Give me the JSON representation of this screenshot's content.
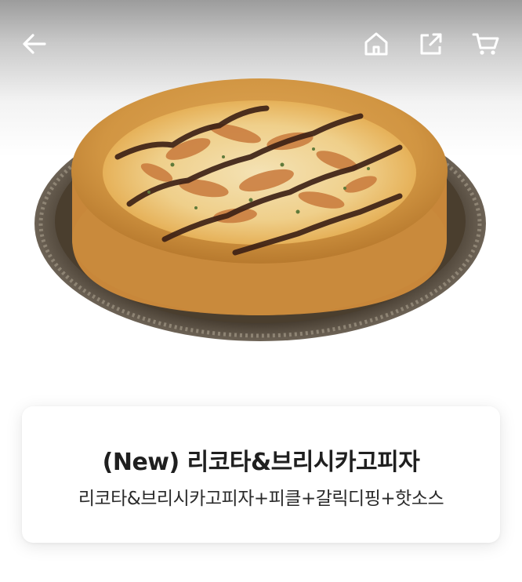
{
  "header": {
    "icons": [
      "back-arrow-icon",
      "home-icon",
      "share-icon",
      "cart-icon"
    ],
    "icon_color": "#ffffff"
  },
  "product": {
    "image_alt": "",
    "title": "(New) 리코타&브리시카고피자",
    "description": "리코타&브리시카고피자+피클+갈릭디핑+핫소스"
  },
  "colors": {
    "header_gradient_top": "#9c9c9c",
    "card_background": "#ffffff",
    "title_text": "#1f1f1f"
  }
}
